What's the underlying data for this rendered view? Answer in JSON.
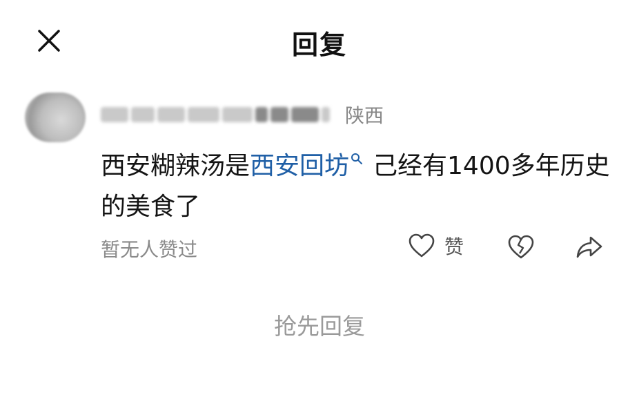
{
  "header": {
    "title": "回复"
  },
  "comment": {
    "location": "陕西",
    "text_before": "西安糊辣汤是",
    "link_text": "西安回坊",
    "text_after": "己经有1400多年历史的美食了"
  },
  "actions": {
    "likes_status": "暂无人赞过",
    "like_label": "赞"
  },
  "reply_prompt": "抢先回复",
  "icons": {
    "close": "close-icon",
    "search": "search-icon",
    "heart": "heart-icon",
    "broken_heart": "broken-heart-icon",
    "share": "share-icon"
  },
  "colors": {
    "link": "#1f5fa6",
    "muted": "#8a8a8a"
  }
}
